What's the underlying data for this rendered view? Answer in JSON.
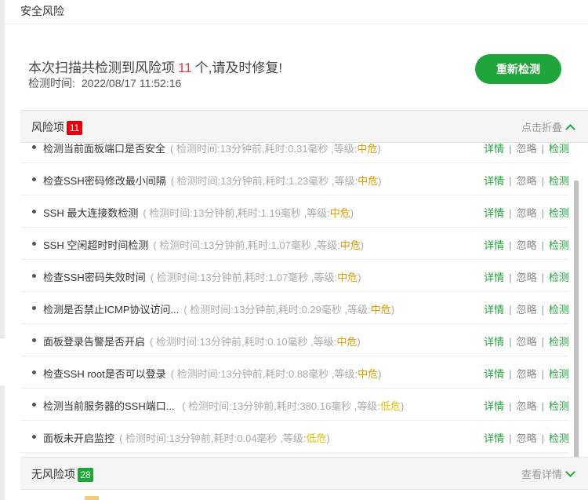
{
  "window": {
    "title": "安全风险"
  },
  "summary": {
    "prefix": "本次扫描共检测到风险项",
    "count": "11",
    "suffix": "个,请及时修复!",
    "time_label": "检测时间:",
    "time_value": "2022/08/17 11:52:16",
    "rescan_label": "重新检测"
  },
  "risk_section": {
    "label": "风险项",
    "count": "11",
    "toggle_label": "点击折叠"
  },
  "risks": [
    {
      "name": "检测当前面板端口是否安全",
      "meta_prefix": "( 检测时间:13分钟前,耗时:0.31毫秒 ,等级:",
      "level": "中危",
      "meta_suffix": ")",
      "detail": "详情",
      "ignore": "忽略",
      "check": "检测"
    },
    {
      "name": "检查SSH密码修改最小间隔",
      "meta_prefix": "( 检测时间:13分钟前,耗时:1.23毫秒 ,等级:",
      "level": "中危",
      "meta_suffix": ")",
      "detail": "详情",
      "ignore": "忽略",
      "check": "检测"
    },
    {
      "name": "SSH 最大连接数检测",
      "meta_prefix": "( 检测时间:13分钟前,耗时:1.19毫秒 ,等级:",
      "level": "中危",
      "meta_suffix": ")",
      "detail": "详情",
      "ignore": "忽略",
      "check": "检测"
    },
    {
      "name": "SSH 空闲超时时间检测",
      "meta_prefix": "( 检测时间:13分钟前,耗时:1.07毫秒 ,等级:",
      "level": "中危",
      "meta_suffix": ")",
      "detail": "详情",
      "ignore": "忽略",
      "check": "检测"
    },
    {
      "name": "检查SSH密码失效时间",
      "meta_prefix": "( 检测时间:13分钟前,耗时:1.07毫秒 ,等级:",
      "level": "中危",
      "meta_suffix": ")",
      "detail": "详情",
      "ignore": "忽略",
      "check": "检测"
    },
    {
      "name": "检测是否禁止ICMP协议访问...",
      "meta_prefix": "( 检测时间:13分钟前,耗时:0.29毫秒 ,等级:",
      "level": "中危",
      "meta_suffix": ")",
      "detail": "详情",
      "ignore": "忽略",
      "check": "检测"
    },
    {
      "name": "面板登录告警是否开启",
      "meta_prefix": "( 检测时间:13分钟前,耗时:0.10毫秒 ,等级:",
      "level": "中危",
      "meta_suffix": ")",
      "detail": "详情",
      "ignore": "忽略",
      "check": "检测"
    },
    {
      "name": "检查SSH root是否可以登录",
      "meta_prefix": "( 检测时间:13分钟前,耗时:0.88毫秒 ,等级:",
      "level": "中危",
      "meta_suffix": ")",
      "detail": "详情",
      "ignore": "忽略",
      "check": "检测"
    },
    {
      "name": "检测当前服务器的SSH端口...",
      "meta_prefix": " ( 检测时间:13分钟前,耗时:380.16毫秒 ,等级:",
      "level": "低危",
      "meta_suffix": ")",
      "detail": "详情",
      "ignore": "忽略",
      "check": "检测"
    },
    {
      "name": "面板未开启监控",
      "meta_prefix": "( 检测时间:13分钟前,耗时:0.04毫秒 ,等级:",
      "level": "低危",
      "meta_suffix": ")",
      "detail": "详情",
      "ignore": "忽略",
      "check": "检测"
    }
  ],
  "safe_section": {
    "label": "无风险项",
    "count": "28",
    "toggle_label": "查看详情"
  },
  "colors": {
    "accent": "#20a53a",
    "danger": "#e4000f",
    "medium": "#e19a00",
    "low": "#e8c400"
  }
}
